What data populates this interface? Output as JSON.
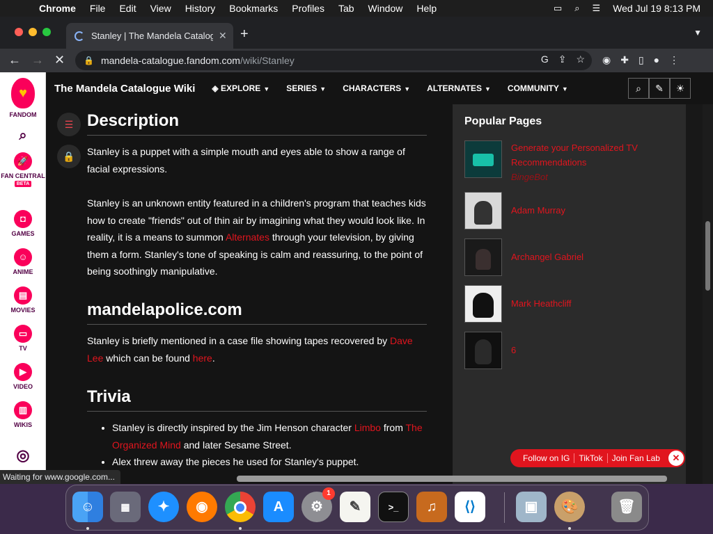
{
  "menubar": {
    "app": "Chrome",
    "items": [
      "File",
      "Edit",
      "View",
      "History",
      "Bookmarks",
      "Profiles",
      "Tab",
      "Window",
      "Help"
    ],
    "datetime": "Wed Jul 19  8:13 PM"
  },
  "browser": {
    "tab_title": "Stanley | The Mandela Catalogue",
    "url_host": "mandela-catalogue.fandom.com",
    "url_path": "/wiki/Stanley",
    "status_text": "Waiting for www.google.com..."
  },
  "fandom_rail": {
    "logo_label": "FANDOM",
    "items": [
      {
        "label": "FAN CENTRAL",
        "icon": "rocket-icon",
        "beta": "BETA"
      },
      {
        "label": "GAMES",
        "icon": "gamepad-icon"
      },
      {
        "label": "ANIME",
        "icon": "anime-icon"
      },
      {
        "label": "MOVIES",
        "icon": "movies-icon"
      },
      {
        "label": "TV",
        "icon": "tv-icon"
      },
      {
        "label": "VIDEO",
        "icon": "video-icon"
      },
      {
        "label": "WIKIS",
        "icon": "wikis-icon"
      }
    ]
  },
  "wiki_nav": {
    "wiki_name": "The Mandela Catalogue Wiki",
    "items": [
      "EXPLORE",
      "SERIES",
      "CHARACTERS",
      "ALTERNATES",
      "COMMUNITY"
    ]
  },
  "article": {
    "description_heading": "Description",
    "desc_p1": "Stanley is a puppet with a simple mouth and eyes able to show a range of facial expressions.",
    "desc_p2_a": "Stanley is an unknown entity featured in a children's program that teaches kids how to create \"friends\" out of thin air by imagining what they would look like. In reality, it is a means to summon ",
    "desc_p2_link": "Alternates",
    "desc_p2_b": " through your television, by giving them a form. Stanley's tone of speaking is calm and reassuring, to the point of being soothingly manipulative.",
    "police_heading": "mandelapolice.com",
    "police_a": "Stanley is briefly mentioned in a case file showing tapes recovered by ",
    "police_link1": "Dave Lee",
    "police_b": " which can be found ",
    "police_link2": "here",
    "police_c": ".",
    "trivia_heading": "Trivia",
    "trivia1_a": "Stanley is directly inspired by the Jim Henson character ",
    "trivia1_link1": "Limbo",
    "trivia1_b": " from ",
    "trivia1_link2": "The Organized Mind",
    "trivia1_c": " and later Sesame Street.",
    "trivia2": "Alex threw away the pieces he used for Stanley's puppet."
  },
  "popular_pages": {
    "title": "Popular Pages",
    "items": [
      {
        "title": "Generate your Personalized TV Recommendations",
        "subtitle": "BingeBot"
      },
      {
        "title": "Adam Murray"
      },
      {
        "title": "Archangel Gabriel"
      },
      {
        "title": "Mark Heathcliff"
      },
      {
        "title": "6"
      }
    ]
  },
  "fan_lab": {
    "items": [
      "Follow on IG",
      "TikTok",
      "Join Fan Lab"
    ]
  },
  "dock": {
    "settings_badge": "1",
    "apps": [
      "finder-icon",
      "launchpad-icon",
      "safari-icon",
      "firefox-icon",
      "chrome-icon",
      "app-store-icon",
      "system-settings-icon",
      "textedit-icon",
      "terminal-icon",
      "garageband-icon",
      "vscode-icon",
      "preview-icon",
      "paintbrush-icon",
      "trash-icon"
    ]
  },
  "colors": {
    "accent": "#e1151e",
    "fandom_pink": "#fa005a",
    "rail_text": "#520044"
  }
}
